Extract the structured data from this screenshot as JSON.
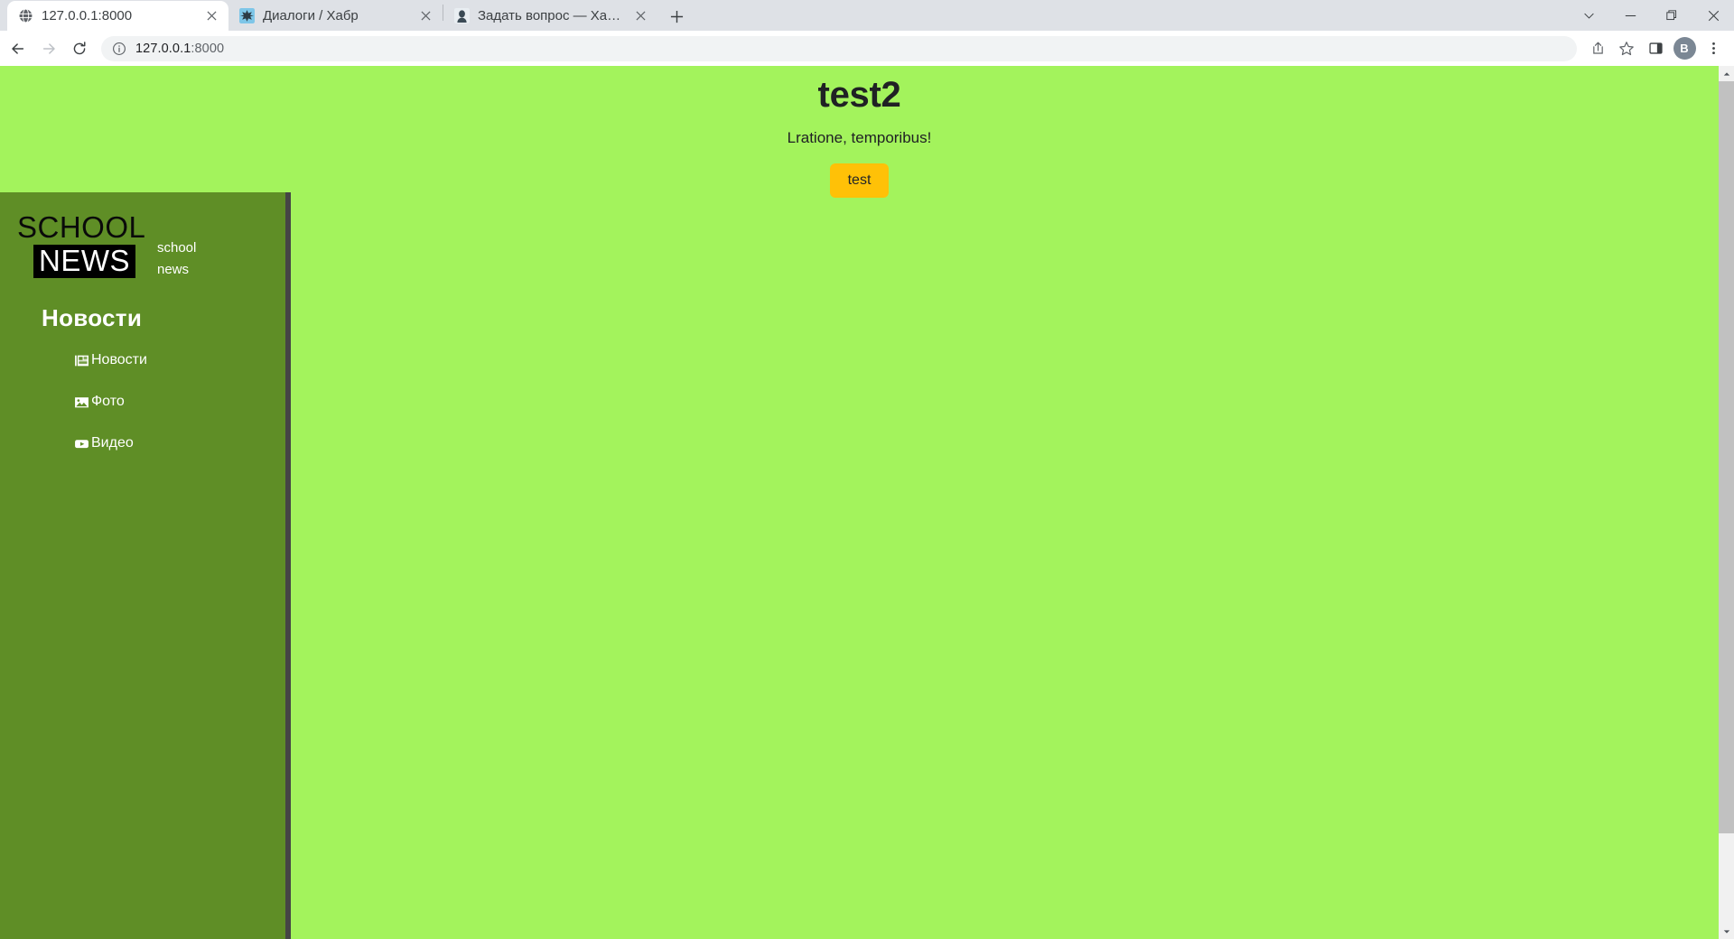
{
  "browser": {
    "tabs": [
      {
        "title": "127.0.0.1:8000",
        "favicon": "globe-icon",
        "active": true
      },
      {
        "title": "Диалоги / Хабр",
        "favicon": "habr-dialogs-icon",
        "active": false
      },
      {
        "title": "Задать вопрос — Хабр Q&A",
        "favicon": "habr-qa-icon",
        "active": false
      }
    ],
    "new_tab_label": "+",
    "window_controls": [
      "tab-search-chevron",
      "minimize",
      "maximize",
      "close"
    ],
    "toolbar": {
      "back_label": "Back",
      "forward_label": "Forward",
      "reload_label": "Reload",
      "url_host": "127.0.0.1",
      "url_port": ":8000",
      "url_full": "127.0.0.1:8000",
      "site_info_label": "View site information",
      "share_label": "Share this page",
      "bookmark_label": "Bookmark this tab",
      "sidepanel_label": "Side panel",
      "profile_initial": "B",
      "menu_label": "Customize and control Google Chrome"
    }
  },
  "page": {
    "title": "test2",
    "subtitle": "Lratione, temporibus!",
    "button_label": "test",
    "background_color": "#a3f35c",
    "button_color": "#ffc107"
  },
  "sidebar": {
    "background_color": "#5f8e26",
    "border_color": "#454545",
    "logo": {
      "top": "SCHOOL",
      "bottom": "NEWS",
      "word_one": "school",
      "word_two": "news"
    },
    "heading": "Новости",
    "items": [
      {
        "label": "Новости",
        "icon": "newspaper-icon"
      },
      {
        "label": "Фото",
        "icon": "image-icon"
      },
      {
        "label": "Видео",
        "icon": "video-icon"
      }
    ]
  },
  "scrollbar": {
    "up_label": "Scroll up",
    "down_label": "Scroll down"
  }
}
